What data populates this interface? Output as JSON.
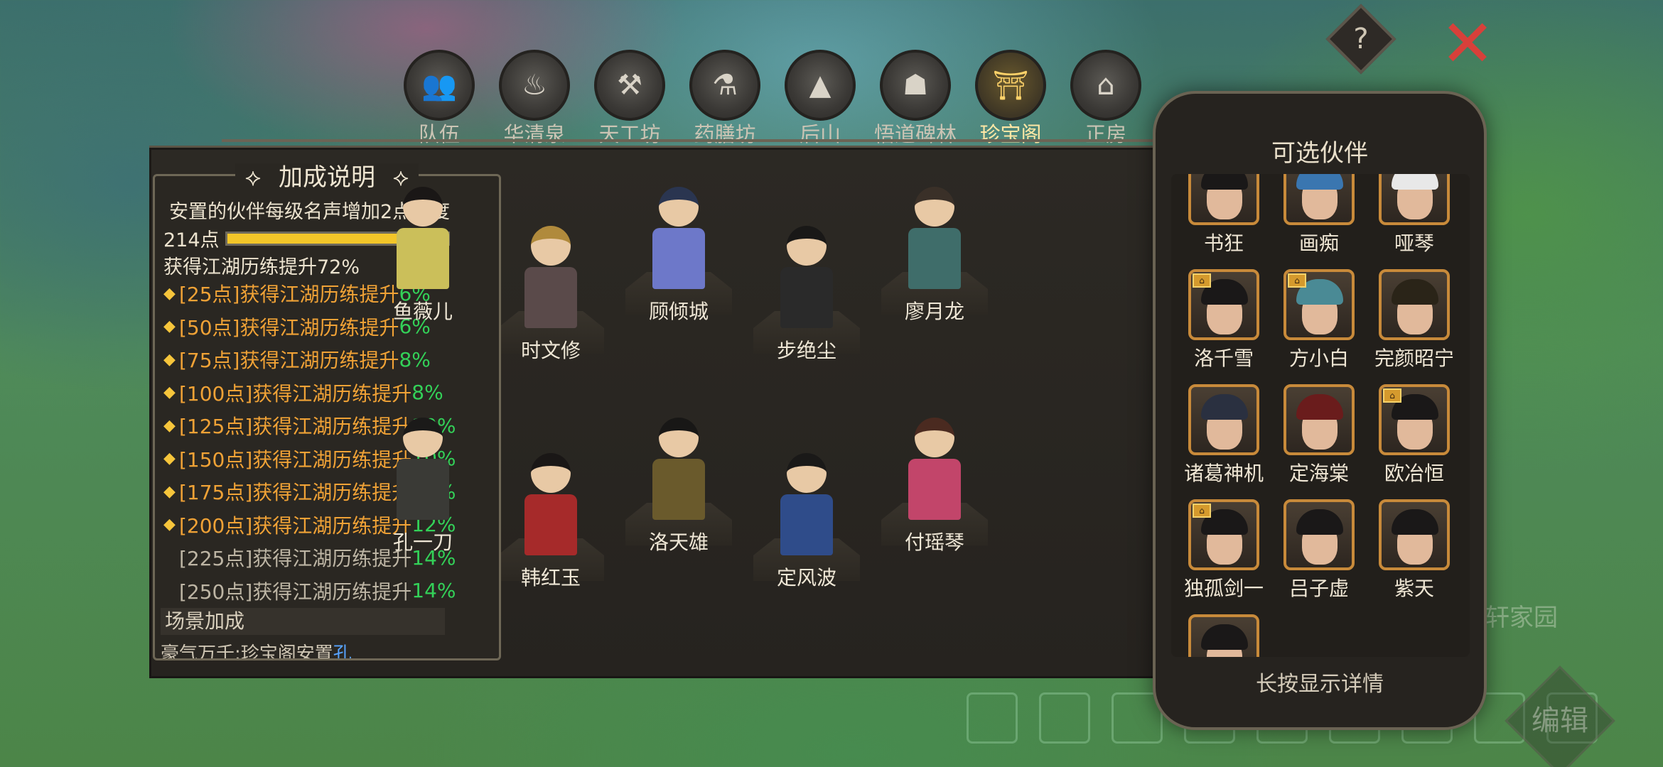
{
  "background_labels": {
    "right_sign": "轩家园"
  },
  "top_buttons": {
    "help_glyph": "?",
    "close_glyph": "✕"
  },
  "tabs": [
    {
      "label": "队伍",
      "icon": "team-icon",
      "glyph": "👥",
      "active": false
    },
    {
      "label": "华清泉",
      "icon": "hot-spring-icon",
      "glyph": "♨",
      "active": false
    },
    {
      "label": "天工坊",
      "icon": "forge-icon",
      "glyph": "⚒",
      "active": false
    },
    {
      "label": "药膳坊",
      "icon": "kitchen-icon",
      "glyph": "⚗",
      "active": false
    },
    {
      "label": "后山",
      "icon": "mountain-icon",
      "glyph": "▲",
      "active": false
    },
    {
      "label": "悟道碑林",
      "icon": "stele-icon",
      "glyph": "☗",
      "active": false
    },
    {
      "label": "珍宝阁",
      "icon": "pagoda-icon",
      "glyph": "⛩",
      "active": true
    },
    {
      "label": "正房",
      "icon": "house-icon",
      "glyph": "⌂",
      "active": false
    }
  ],
  "info_panel": {
    "title": "加成说明",
    "description": "安置的伙伴每级名声增加2点进度",
    "points": "214点",
    "progress_fraction": 0.86,
    "current_bonus": "获得江湖历练提升72%",
    "tiers": [
      {
        "text": "[25点]获得江湖历练提升",
        "pct": "6%",
        "unlocked": true
      },
      {
        "text": "[50点]获得江湖历练提升",
        "pct": "6%",
        "unlocked": true
      },
      {
        "text": "[75点]获得江湖历练提升",
        "pct": "8%",
        "unlocked": true
      },
      {
        "text": "[100点]获得江湖历练提升",
        "pct": "8%",
        "unlocked": true
      },
      {
        "text": "[125点]获得江湖历练提升",
        "pct": "10%",
        "unlocked": true
      },
      {
        "text": "[150点]获得江湖历练提升",
        "pct": "10%",
        "unlocked": true
      },
      {
        "text": "[175点]获得江湖历练提升",
        "pct": "12%",
        "unlocked": true
      },
      {
        "text": "[200点]获得江湖历练提升",
        "pct": "12%",
        "unlocked": true
      },
      {
        "text": "[225点]获得江湖历练提升",
        "pct": "14%",
        "unlocked": false
      },
      {
        "text": "[250点]获得江湖历练提升",
        "pct": "14%",
        "unlocked": false
      }
    ],
    "scene_label": "场景加成",
    "scene_sub_text": "豪气万千:珍宝阁安置",
    "scene_sub_highlight": "孔"
  },
  "characters": [
    {
      "name": "鱼薇儿",
      "hair": "#1a1716",
      "cloth": "#cbbf5a"
    },
    {
      "name": "时文修",
      "hair": "#b08a3c",
      "cloth": "#5a4a4a"
    },
    {
      "name": "顾倾城",
      "hair": "#2a3550",
      "cloth": "#6d78c9"
    },
    {
      "name": "步绝尘",
      "hair": "#191817",
      "cloth": "#2a2a2a"
    },
    {
      "name": "廖月龙",
      "hair": "#3a3028",
      "cloth": "#3f6d6a"
    },
    {
      "name": "孔一刀",
      "hair": "#1b1a19",
      "cloth": "#3a3a36"
    },
    {
      "name": "韩红玉",
      "hair": "#1a1716",
      "cloth": "#a62a2a"
    },
    {
      "name": "洛天雄",
      "hair": "#181716",
      "cloth": "#6a5a2c"
    },
    {
      "name": "定风波",
      "hair": "#1a1918",
      "cloth": "#2f4c8a"
    },
    {
      "name": "付瑶琴",
      "hair": "#4a2a20",
      "cloth": "#c2456a"
    }
  ],
  "side_panel": {
    "title": "可选伙伴",
    "hint": "长按显示详情",
    "partners": [
      {
        "name": "书狂",
        "badge": true,
        "hair": "#1a1818"
      },
      {
        "name": "画痴",
        "badge": true,
        "hair": "#3a76b0"
      },
      {
        "name": "哑琴",
        "badge": true,
        "hair": "#e8e8e8"
      },
      {
        "name": "洛千雪",
        "badge": true,
        "hair": "#1a1818"
      },
      {
        "name": "方小白",
        "badge": true,
        "hair": "#4a8a95"
      },
      {
        "name": "完颜昭宁",
        "badge": false,
        "hair": "#2a2418"
      },
      {
        "name": "诸葛神机",
        "badge": false,
        "hair": "#2a3040"
      },
      {
        "name": "定海棠",
        "badge": false,
        "hair": "#6a1c1c"
      },
      {
        "name": "欧冶恒",
        "badge": true,
        "hair": "#1a1818"
      },
      {
        "name": "独孤剑一",
        "badge": true,
        "hair": "#1a1818"
      },
      {
        "name": "吕子虚",
        "badge": false,
        "hair": "#1a1818"
      },
      {
        "name": "紫天",
        "badge": false,
        "hair": "#1a1818"
      },
      {
        "name": "",
        "badge": false,
        "hair": "#1a1818"
      }
    ]
  },
  "edit_button": "编辑",
  "colors": {
    "accent_gold": "#f3c629",
    "bonus_green": "#33d158",
    "tier_orange": "#f0a236",
    "close_red": "#d8403a"
  }
}
